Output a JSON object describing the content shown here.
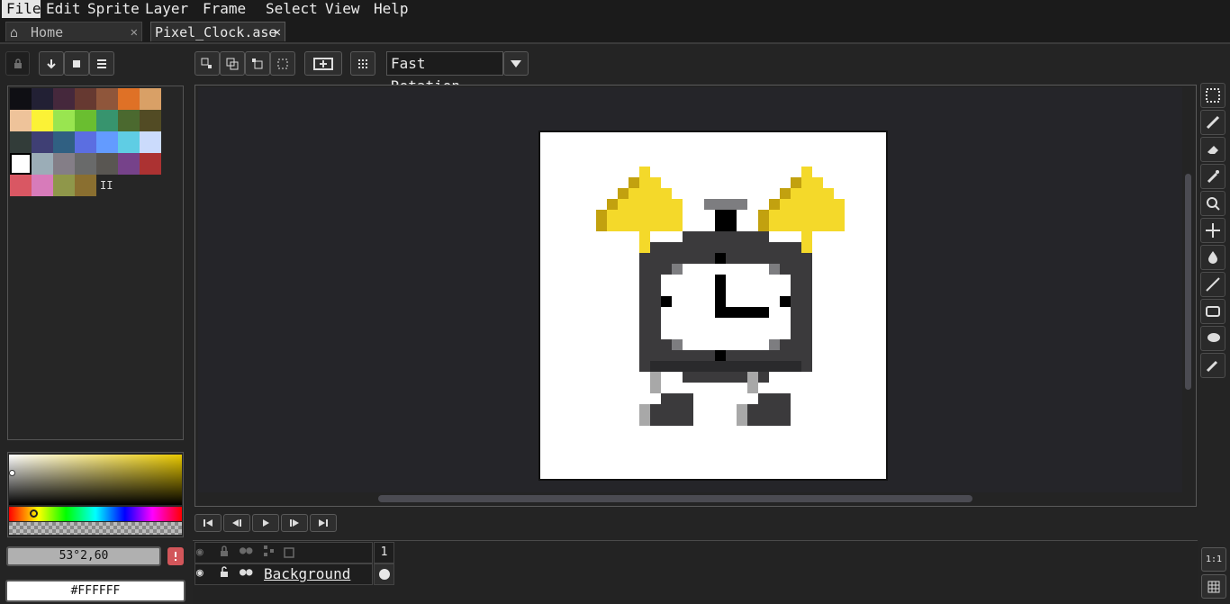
{
  "menu": [
    {
      "label": "File",
      "accel": "F",
      "active": true
    },
    {
      "label": "Edit",
      "accel": "E"
    },
    {
      "label": "Sprite",
      "accel": "S"
    },
    {
      "label": "Layer",
      "accel": "L"
    },
    {
      "label": "Frame",
      "accel": "r"
    },
    {
      "label": "Select",
      "accel": "c"
    },
    {
      "label": "View",
      "accel": "V"
    },
    {
      "label": "Help",
      "accel": "H"
    }
  ],
  "tabs": [
    {
      "label": "Home",
      "icon": "home-icon"
    },
    {
      "label": "Pixel_Clock.ase",
      "active": true
    }
  ],
  "toolbar": {
    "rotation_algorithm": "Fast Rotation"
  },
  "palette": {
    "colors": [
      "#0f0f14",
      "#222034",
      "#45283c",
      "#663931",
      "#8f563b",
      "#df7126",
      "#d9a066",
      "#eec39a",
      "#fbf236",
      "#99e550",
      "#6abe30",
      "#37946e",
      "#4b692f",
      "#524b24",
      "#323c39",
      "#3f3f74",
      "#306082",
      "#5b6ee1",
      "#639bff",
      "#5fcde4",
      "#cbdbfc",
      "#ffffff",
      "#9badb7",
      "#847e87",
      "#696a6a",
      "#595652",
      "#76428a",
      "#ac3232",
      "#d95763",
      "#d77bba",
      "#8f974a",
      "#8a6f30"
    ],
    "selected_index": 21,
    "more_marker": "II"
  },
  "color_picker": {
    "hue_gradient": "yellow",
    "hsv_value": "53°2,60",
    "hex_value": "#FFFFFF",
    "warning_icon": "warning-icon"
  },
  "timeline": {
    "frame_number": "1",
    "layer_name": "Background"
  },
  "colors": {
    "bell_yellow": "#f4d92a",
    "bell_shadow": "#c2a10f",
    "clock_dark": "#3b3a3c",
    "clock_frame": "#2a2a2c",
    "clock_light": "#ffffff",
    "clock_grey": "#7d7d80",
    "foot_grey": "#a8a8a8",
    "ink": "#000000"
  }
}
